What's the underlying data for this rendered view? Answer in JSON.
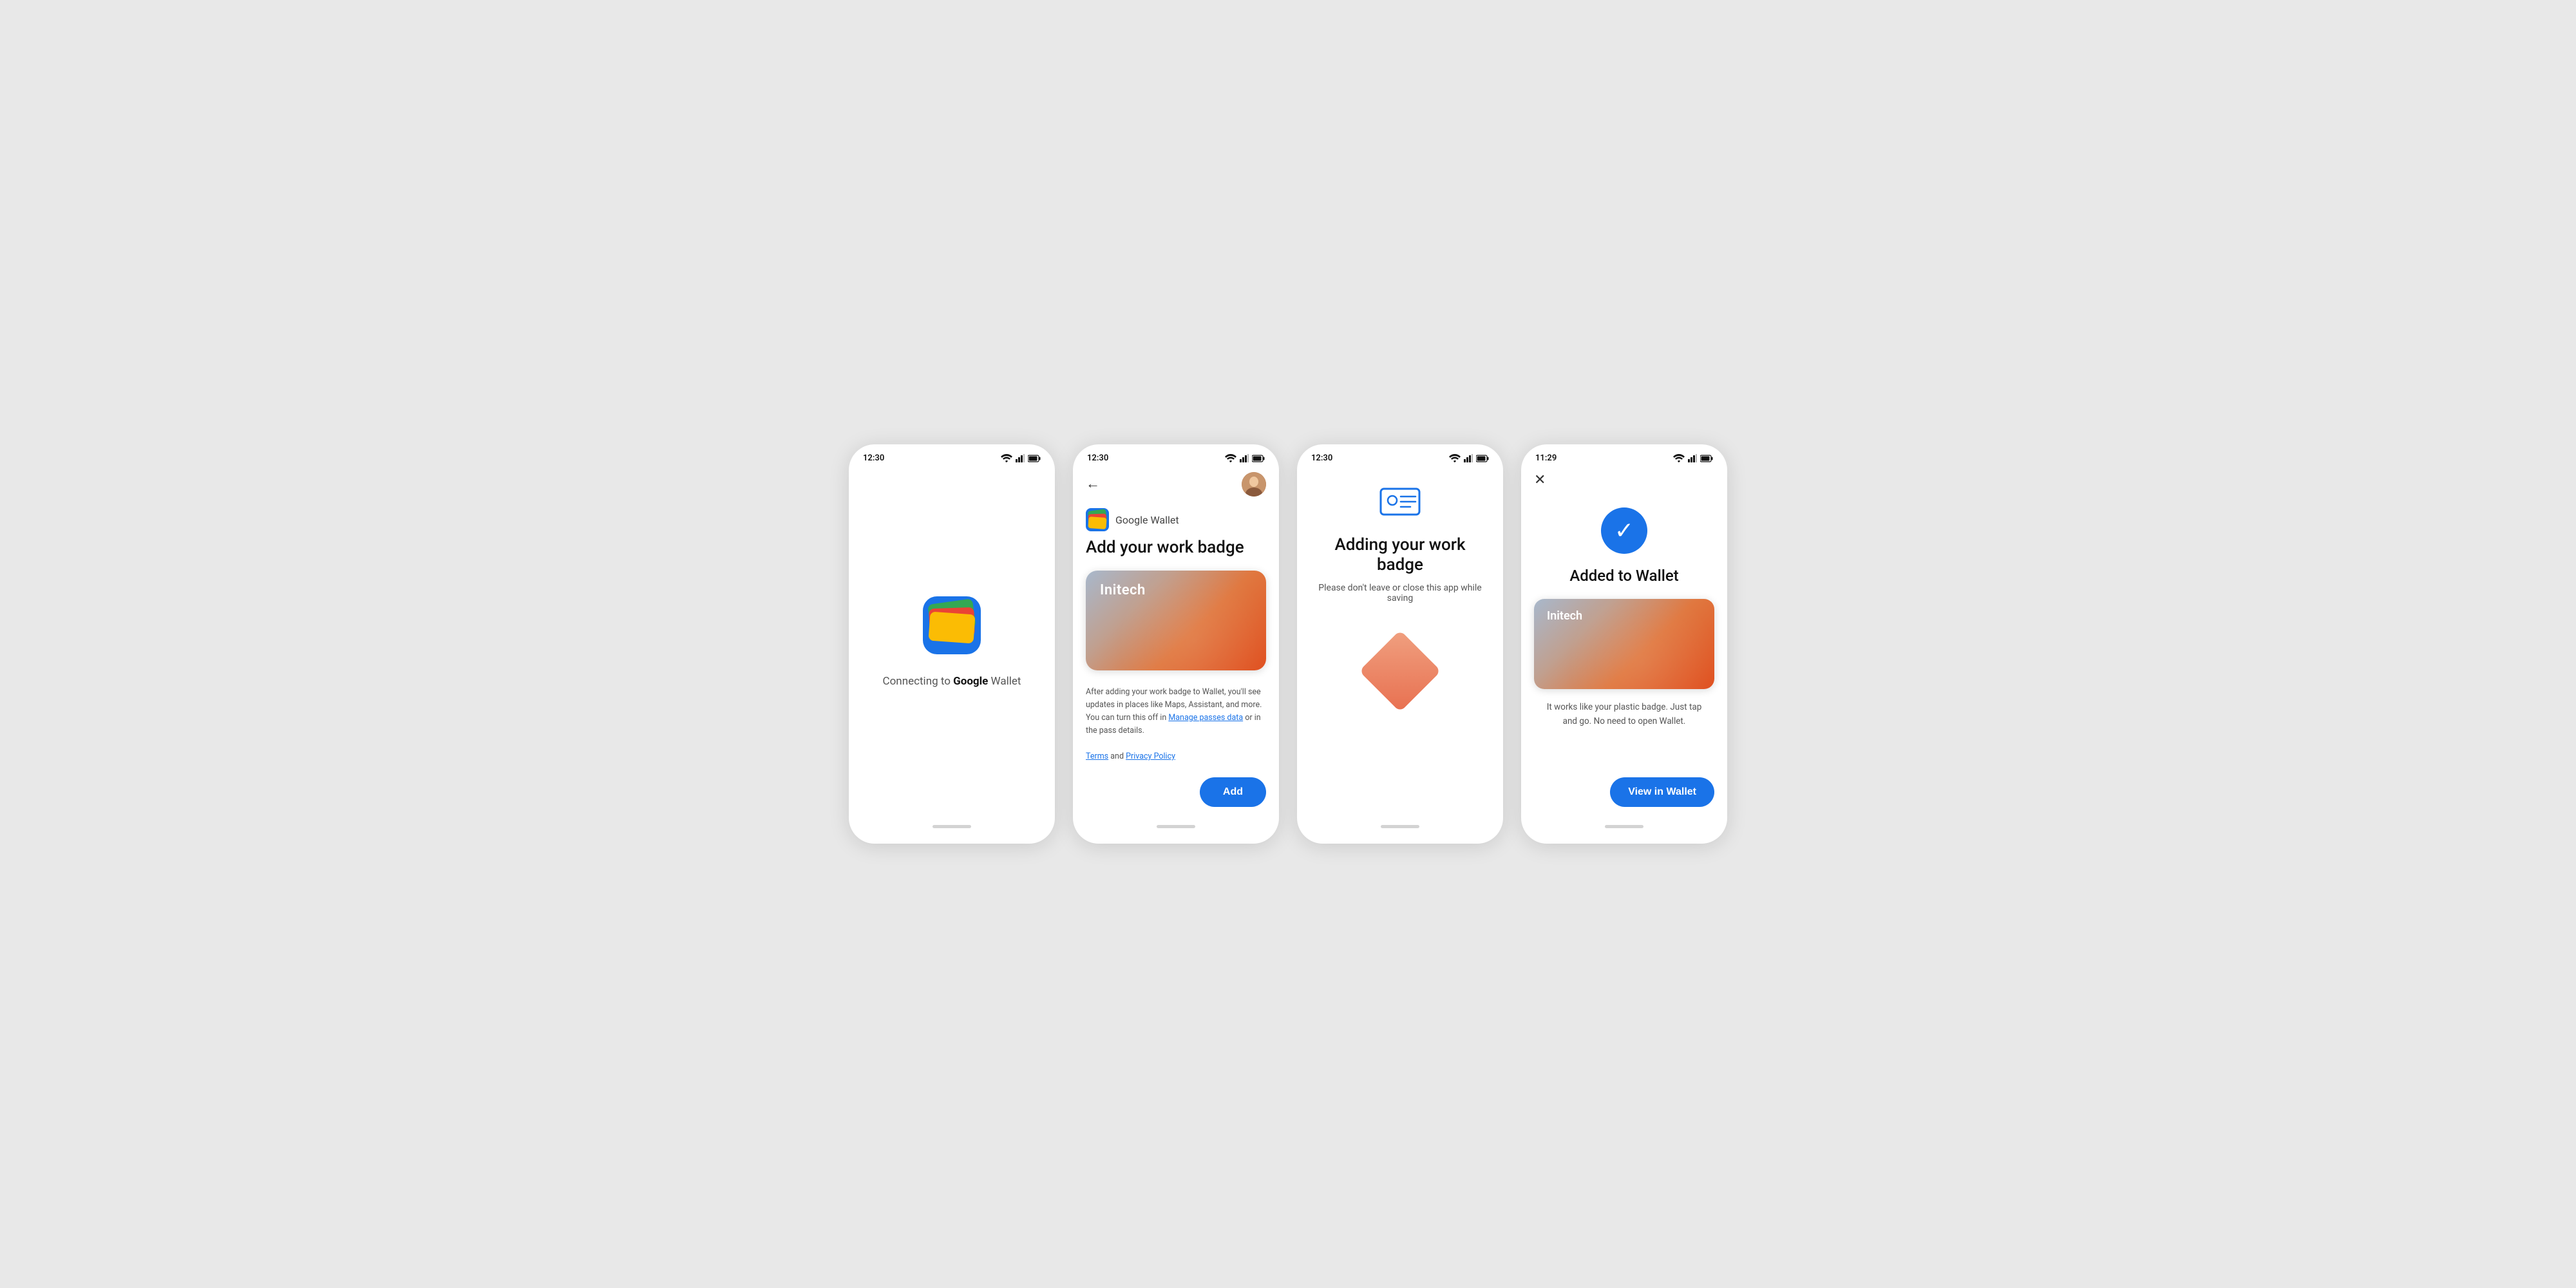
{
  "screens": [
    {
      "id": "screen1",
      "status_time": "12:30",
      "connecting_text_prefix": "Connecting to ",
      "connecting_text_brand": "Google",
      "connecting_text_suffix": " Wallet"
    },
    {
      "id": "screen2",
      "status_time": "12:30",
      "brand_name": "Google Wallet",
      "title": "Add your work badge",
      "badge_company": "Initech",
      "footer_text": "After adding your work badge to Wallet, you'll see updates in places like Maps, Assistant, and more. You can turn this off in ",
      "footer_link1": "Manage passes data",
      "footer_middle": " or in the pass details.",
      "footer_terms": "Terms",
      "footer_and": " and ",
      "footer_privacy": "Privacy Policy",
      "add_button": "Add"
    },
    {
      "id": "screen3",
      "status_time": "12:30",
      "title": "Adding your work badge",
      "subtitle": "Please don't leave or close this app while saving"
    },
    {
      "id": "screen4",
      "status_time": "11:29",
      "success_title": "Added to Wallet",
      "badge_company": "Initech",
      "description": "It works like your plastic badge. Just tap and go. No need to open Wallet.",
      "view_button": "View in Wallet"
    }
  ]
}
